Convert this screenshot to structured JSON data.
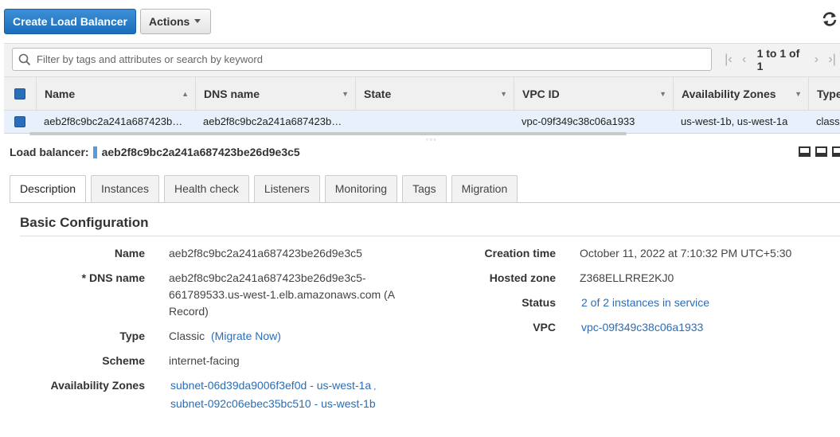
{
  "toolbar": {
    "create_label": "Create Load Balancer",
    "actions_label": "Actions"
  },
  "search": {
    "placeholder": "Filter by tags and attributes or search by keyword"
  },
  "pager": {
    "text": "1 to 1 of 1"
  },
  "table": {
    "columns": [
      "Name",
      "DNS name",
      "State",
      "VPC ID",
      "Availability Zones",
      "Type"
    ],
    "row": {
      "name": "aeb2f8c9bc2a241a687423b…",
      "dns": "aeb2f8c9bc2a241a687423b…",
      "state": "",
      "vpc": "vpc-09f349c38c06a1933",
      "zones": "us-west-1b, us-west-1a",
      "type": "classic"
    }
  },
  "detail": {
    "header_label": "Load balancer:",
    "header_value": "aeb2f8c9bc2a241a687423be26d9e3c5",
    "tabs": [
      "Description",
      "Instances",
      "Health check",
      "Listeners",
      "Monitoring",
      "Tags",
      "Migration"
    ],
    "section_title": "Basic Configuration",
    "left": {
      "name_label": "Name",
      "name_value": "aeb2f8c9bc2a241a687423be26d9e3c5",
      "dns_label": "* DNS name",
      "dns_line1": "aeb2f8c9bc2a241a687423be26d9e3c5-",
      "dns_line2": "661789533.us-west-1.elb.amazonaws.com (A",
      "dns_line3": "Record)",
      "type_label": "Type",
      "type_value": "Classic",
      "type_link": "(Migrate Now)",
      "scheme_label": "Scheme",
      "scheme_value": "internet-facing",
      "zones_label": "Availability Zones",
      "zone1": "subnet-06d39da9006f3ef0d - us-west-1a",
      "zone_sep": ",",
      "zone2": "subnet-092c06ebec35bc510 - us-west-1b"
    },
    "right": {
      "created_label": "Creation time",
      "created_value": "October 11, 2022 at 7:10:32 PM UTC+5:30",
      "zone_label": "Hosted zone",
      "zone_value": "Z368ELLRRE2KJ0",
      "status_label": "Status",
      "status_value": "2 of 2 instances in service",
      "vpc_label": "VPC",
      "vpc_value": "vpc-09f349c38c06a1933"
    }
  },
  "colors": {
    "primary": "#1a6dbb",
    "link": "#2b6db5",
    "row_selected": "#e8f1fb"
  }
}
